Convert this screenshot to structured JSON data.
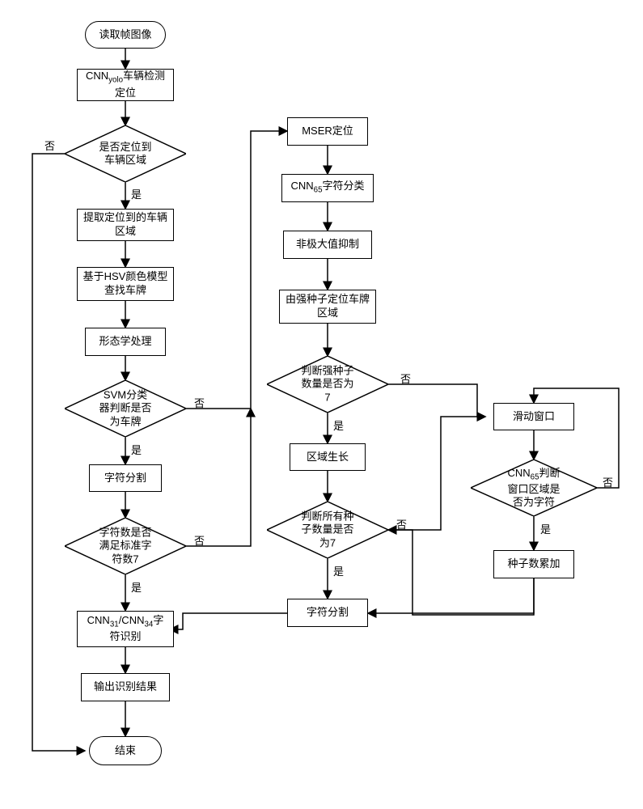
{
  "nodes": {
    "start": "读取帧图像",
    "yolo": "CNN<sub>yolo</sub>车辆检测定位",
    "d1": "是否定位到车辆区域",
    "extract": "提取定位到的车辆区域",
    "hsv": "基于HSV颜色模型查找车牌",
    "morph": "形态学处理",
    "d2": "SVM分类器判断是否为车牌",
    "seg1": "字符分割",
    "d3": "字符数是否满足标准字符数7",
    "recog": "CNN<sub>31</sub>/CNN<sub>34</sub>字符识别",
    "output": "输出识别结果",
    "end": "结束",
    "mser": "MSER定位",
    "cnn65a": "CNN<sub>65</sub>字符分类",
    "nms": "非极大值抑制",
    "seedloc": "由强种子定位车牌区域",
    "d4": "判断强种子数量是否为7",
    "grow": "区域生长",
    "d5": "判断所有种子数量是否为7",
    "seg2": "字符分割",
    "slide": "滑动窗口",
    "d6": "CNN<sub>65</sub>判断窗口区域是否为字符",
    "seedadd": "种子数累加"
  },
  "labels": {
    "yes": "是",
    "no": "否"
  }
}
